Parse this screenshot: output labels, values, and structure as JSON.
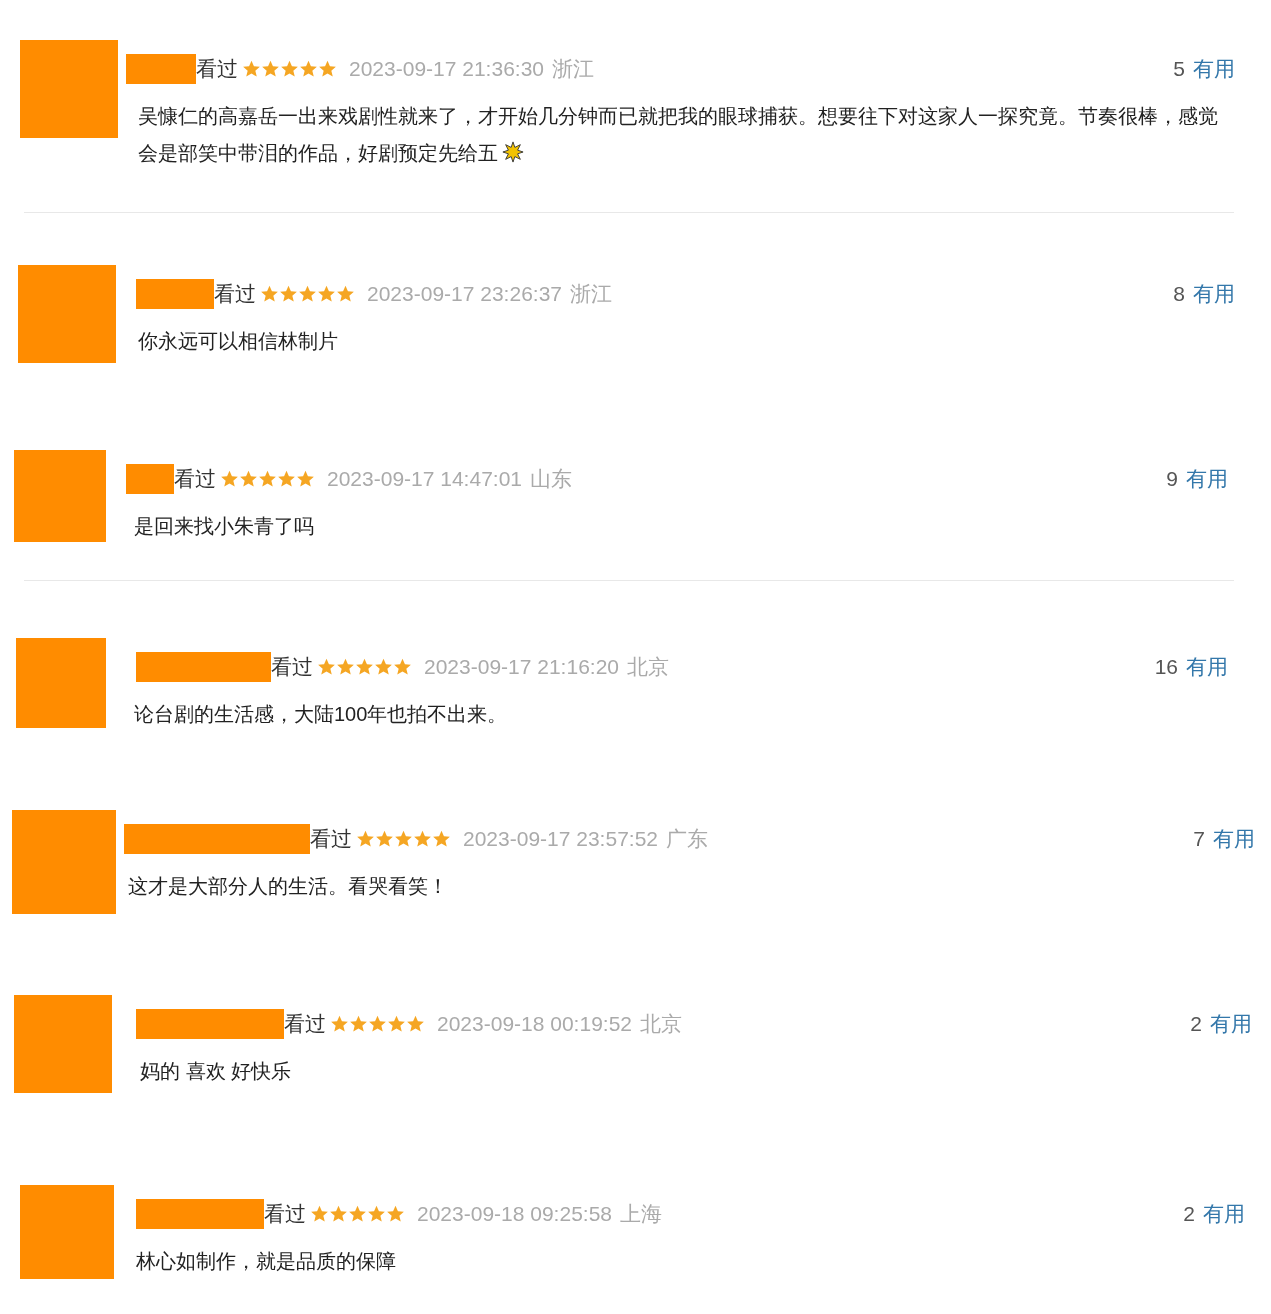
{
  "reviews": [
    {
      "status": "看过",
      "stars": 5,
      "time": "2023-09-17 21:36:30",
      "location": "浙江",
      "votes": "5",
      "vote_label": "有用",
      "text": "吴慷仁的高嘉岳一出来戏剧性就来了，才开始几分钟而已就把我的眼球捕获。想要往下对这家人一探究竟。节奏很棒，感觉会是部笑中带泪的作品，好剧预定先给五",
      "sparkle": true,
      "divider_after": true
    },
    {
      "status": "看过",
      "stars": 5,
      "time": "2023-09-17 23:26:37",
      "location": "浙江",
      "votes": "8",
      "vote_label": "有用",
      "text": "你永远可以相信林制片",
      "sparkle": false,
      "divider_after": false
    },
    {
      "status": "看过",
      "stars": 5,
      "time": "2023-09-17 14:47:01",
      "location": "山东",
      "votes": "9",
      "vote_label": "有用",
      "text": "是回来找小朱青了吗",
      "sparkle": false,
      "divider_after": true
    },
    {
      "status": "看过",
      "stars": 5,
      "time": "2023-09-17 21:16:20",
      "location": "北京",
      "votes": "16",
      "vote_label": "有用",
      "text": "论台剧的生活感，大陆100年也拍不出来。",
      "sparkle": false,
      "divider_after": false
    },
    {
      "status": "看过",
      "stars": 5,
      "time": "2023-09-17 23:57:52",
      "location": "广东",
      "votes": "7",
      "vote_label": "有用",
      "text": "这才是大部分人的生活。看哭看笑！",
      "sparkle": false,
      "divider_after": false
    },
    {
      "status": "看过",
      "stars": 5,
      "time": "2023-09-18 00:19:52",
      "location": "北京",
      "votes": "2",
      "vote_label": "有用",
      "text": "妈的 喜欢 好快乐",
      "sparkle": false,
      "divider_after": false
    },
    {
      "status": "看过",
      "stars": 5,
      "time": "2023-09-18 09:25:58",
      "location": "上海",
      "votes": "2",
      "vote_label": "有用",
      "text": "林心如制作，就是品质的保障",
      "sparkle": false,
      "divider_after": false
    }
  ]
}
